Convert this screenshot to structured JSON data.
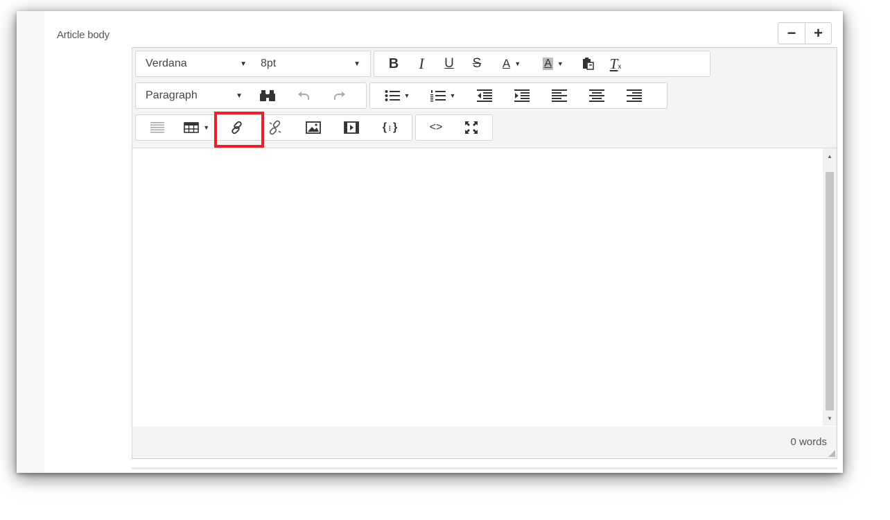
{
  "field": {
    "label": "Article body"
  },
  "zoom": {
    "decrease": "−",
    "increase": "+"
  },
  "toolbar": {
    "font_family": "Verdana",
    "font_size": "8pt",
    "block_format": "Paragraph",
    "icons": {
      "bold": "B",
      "italic": "I",
      "underline": "U",
      "strikethrough": "S",
      "text_color": "A",
      "bg_color": "A",
      "clear_format": "T",
      "source_code": "<>"
    }
  },
  "status": {
    "word_count": "0 words"
  },
  "colors": {
    "highlight": "#e3232c",
    "toolbar_bg": "#f4f4f4",
    "border": "#d4d4d4"
  }
}
